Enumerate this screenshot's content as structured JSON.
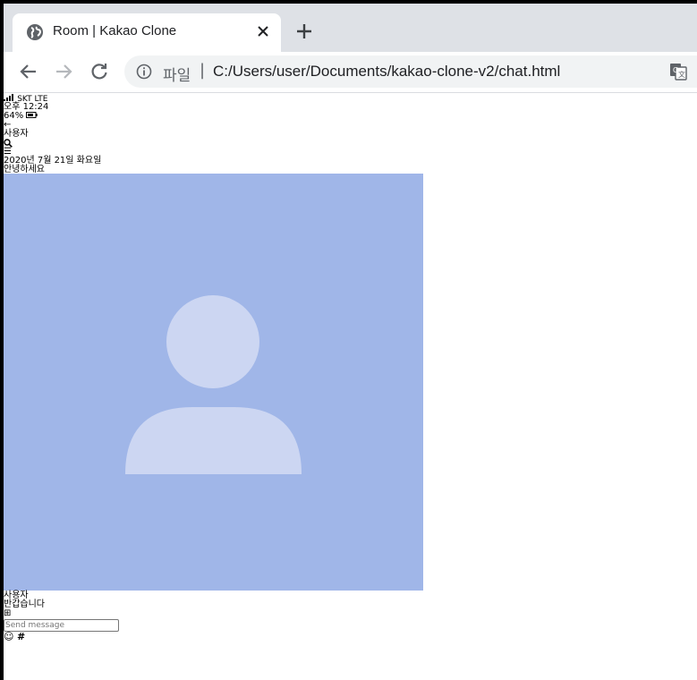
{
  "browser": {
    "tab_title": "Room | Kakao Clone",
    "omnibox_scheme": "파일",
    "omnibox_separator": "|",
    "url": "C:/Users/user/Documents/kakao-clone-v2/chat.html"
  },
  "status_bar": {
    "carrier": "SKT LTE",
    "time": "오후 12:24",
    "battery": "64%"
  },
  "header": {
    "back_icon": "←",
    "title": "사용자",
    "search_icon": "search-icon",
    "menu_icon": "☰"
  },
  "chat": {
    "date": "2020년 7월 21일 화요일",
    "first_message": "안녕하세요",
    "sender_name": "사용자",
    "second_message": "반갑습니다"
  },
  "composer": {
    "plus_icon": "⊞",
    "placeholder": "Send message",
    "emoji_icon": "☺",
    "hash_icon": "#"
  },
  "colors": {
    "avatar_bg": "#a0b6e8",
    "avatar_fg": "#ccd6f2"
  }
}
